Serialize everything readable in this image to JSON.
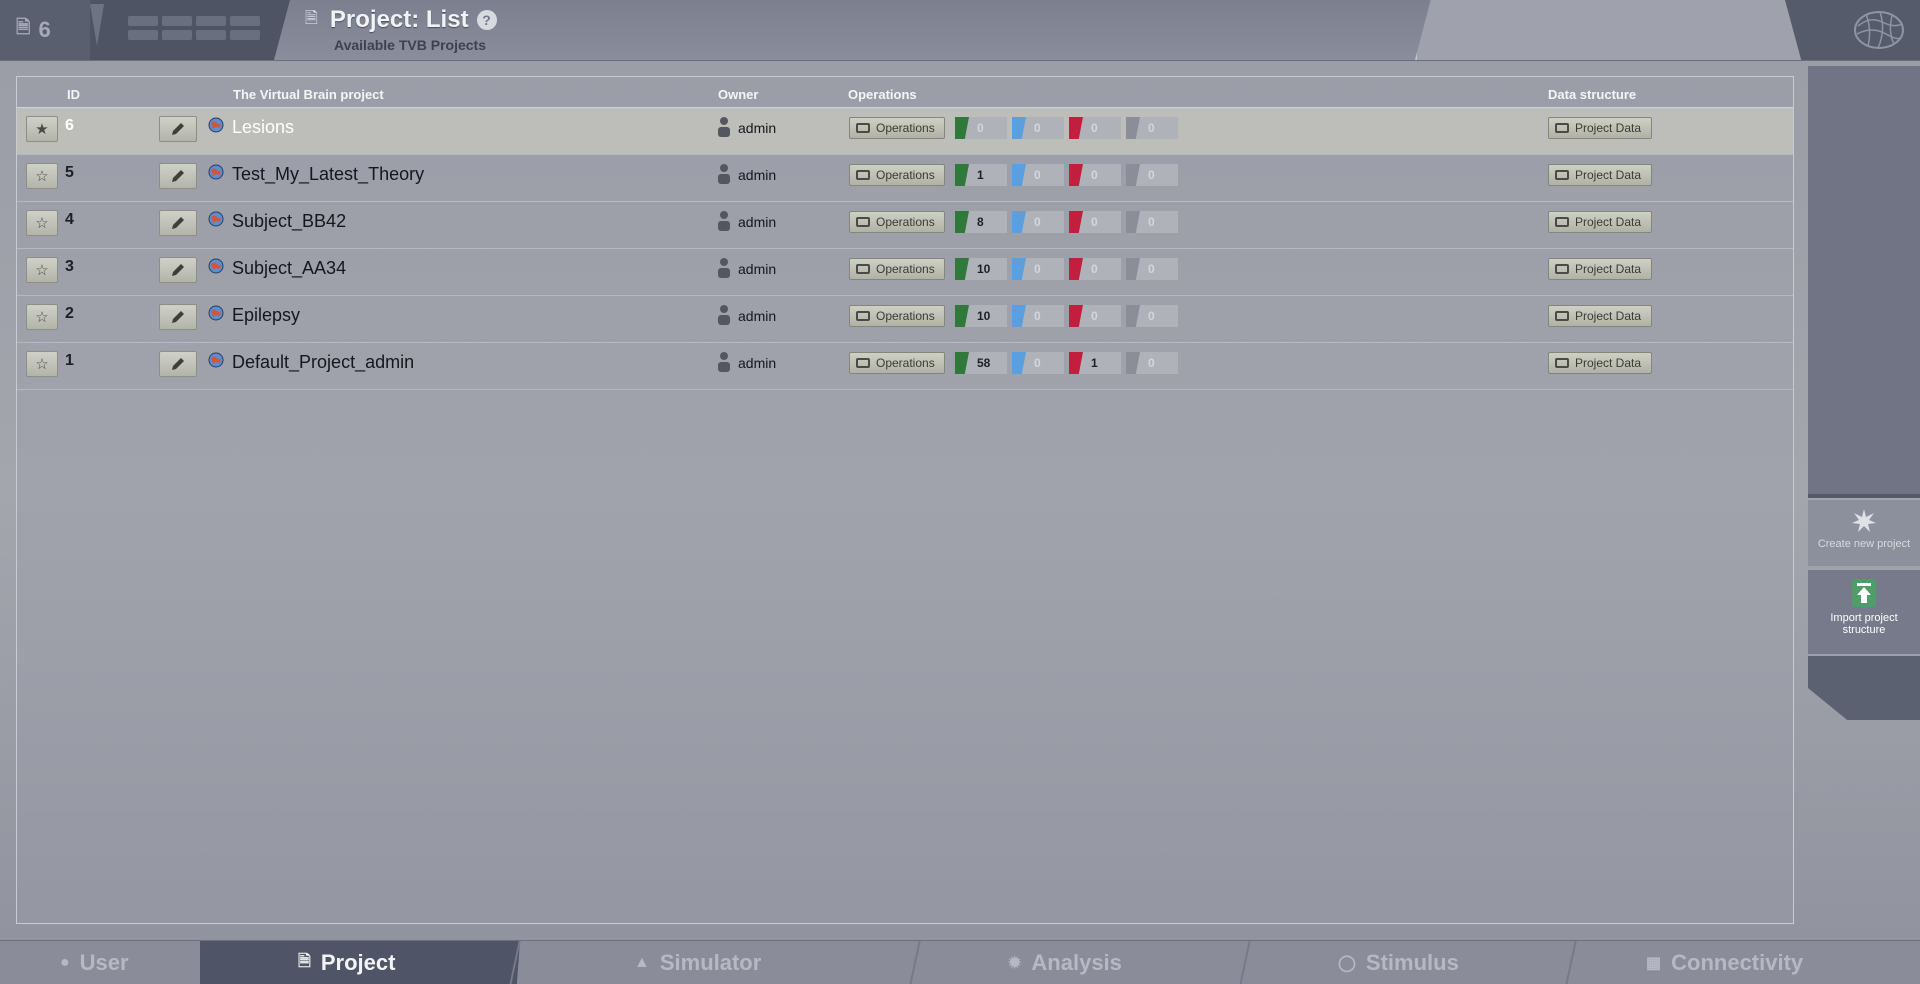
{
  "header": {
    "project_count": "6",
    "title": "Project: List",
    "help": "?",
    "subtitle": "Available TVB Projects"
  },
  "table": {
    "columns": {
      "id": "ID",
      "name": "The Virtual Brain project",
      "owner": "Owner",
      "operations": "Operations",
      "data_structure": "Data structure"
    },
    "operations_label": "Operations",
    "project_data_label": "Project Data",
    "rows": [
      {
        "id": "6",
        "name": "Lesions",
        "owner": "admin",
        "finished": "0",
        "started": "0",
        "error": "0",
        "canceled": "0",
        "selected": true
      },
      {
        "id": "5",
        "name": "Test_My_Latest_Theory",
        "owner": "admin",
        "finished": "1",
        "started": "0",
        "error": "0",
        "canceled": "0",
        "selected": false
      },
      {
        "id": "4",
        "name": "Subject_BB42",
        "owner": "admin",
        "finished": "8",
        "started": "0",
        "error": "0",
        "canceled": "0",
        "selected": false
      },
      {
        "id": "3",
        "name": "Subject_AA34",
        "owner": "admin",
        "finished": "10",
        "started": "0",
        "error": "0",
        "canceled": "0",
        "selected": false
      },
      {
        "id": "2",
        "name": "Epilepsy",
        "owner": "admin",
        "finished": "10",
        "started": "0",
        "error": "0",
        "canceled": "0",
        "selected": false
      },
      {
        "id": "1",
        "name": "Default_Project_admin",
        "owner": "admin",
        "finished": "58",
        "started": "0",
        "error": "1",
        "canceled": "0",
        "selected": false
      }
    ]
  },
  "side_actions": {
    "create": "Create new project",
    "import": "Import project structure"
  },
  "bottom_nav": {
    "tabs": [
      "User",
      "Project",
      "Simulator",
      "Analysis",
      "Stimulus",
      "Connectivity"
    ],
    "active": "Project"
  },
  "colors": {
    "finished": "#2f7a3a",
    "started": "#5aa0e0",
    "error": "#c21f3f",
    "canceled": "#8b8e99"
  }
}
